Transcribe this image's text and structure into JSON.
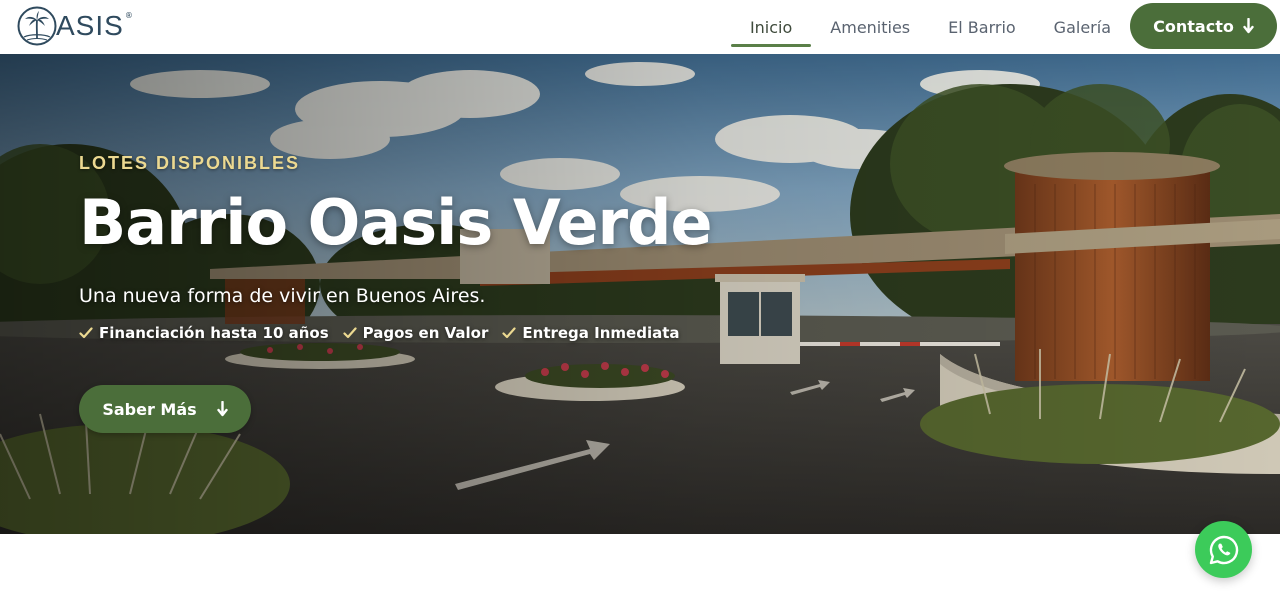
{
  "brand": {
    "logo_text": "ASIS",
    "logo_mark": "palm-tree-circle-icon",
    "registered_mark": "®",
    "brand_color": "#2f4a5e"
  },
  "nav": {
    "items": [
      {
        "label": "Inicio",
        "active": true
      },
      {
        "label": "Amenities",
        "active": false
      },
      {
        "label": "El Barrio",
        "active": false
      },
      {
        "label": "Galería",
        "active": false
      }
    ],
    "contact_label": "Contacto",
    "contact_icon": "arrow-down-icon",
    "accent_color": "#4b6e3a"
  },
  "hero": {
    "eyebrow": "LOTES DISPONIBLES",
    "title": "Barrio Oasis Verde",
    "subtitle": "Una nueva forma de vivir en Buenos Aires.",
    "features": [
      {
        "label": "Financiación hasta 10 años",
        "icon": "check-icon"
      },
      {
        "label": "Pagos en Valor",
        "icon": "check-icon"
      },
      {
        "label": "Entrega Inmediata",
        "icon": "check-icon"
      }
    ],
    "cta_label": "Saber Más",
    "cta_icon": "arrow-down-icon",
    "eyebrow_color": "#ecd991"
  },
  "floating": {
    "whatsapp_icon": "whatsapp-icon",
    "whatsapp_color": "#3ccb5a"
  }
}
